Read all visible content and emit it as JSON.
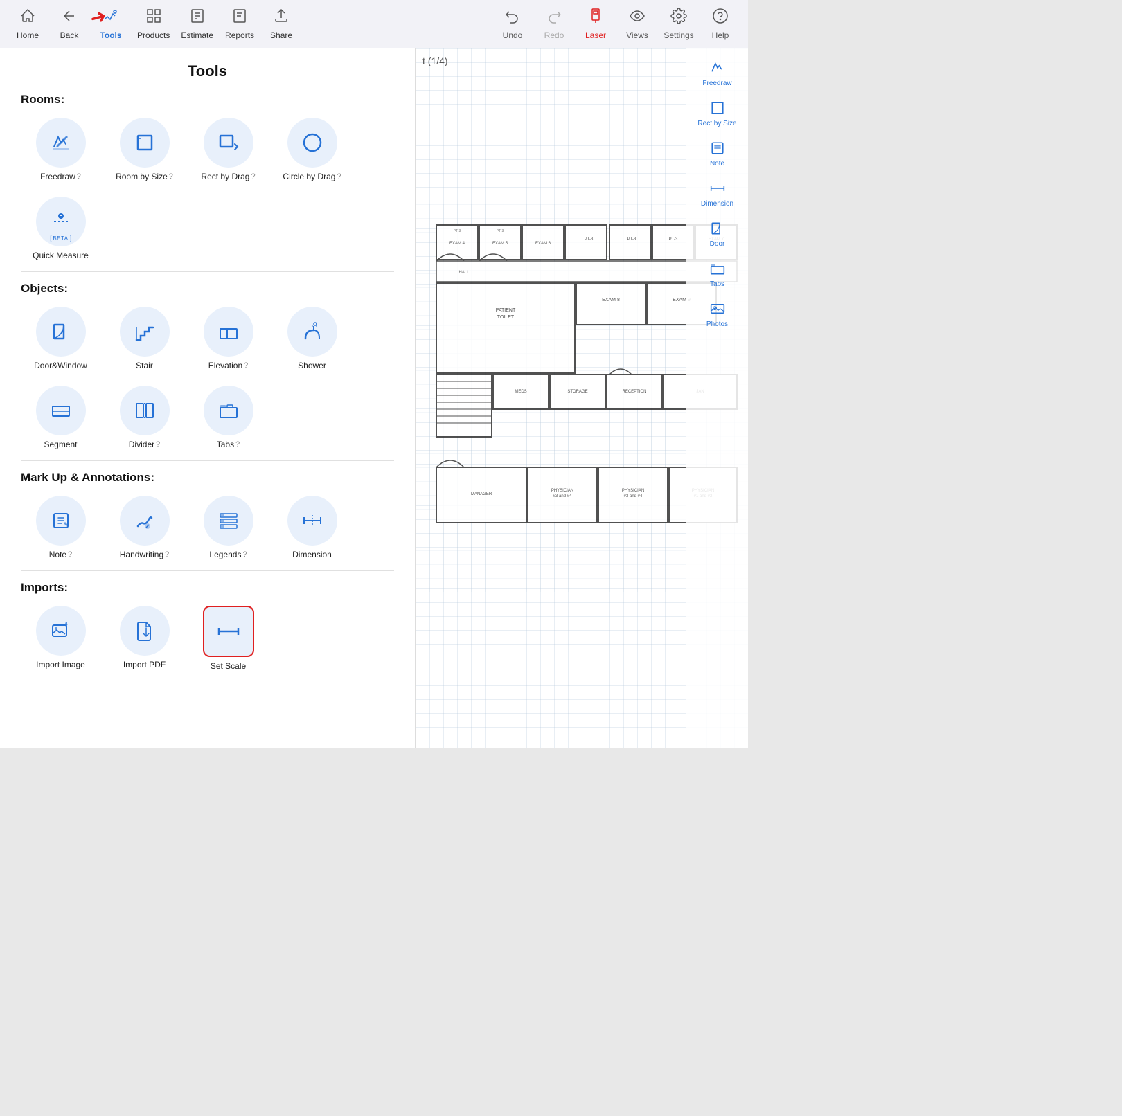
{
  "toolbar": {
    "title": "Tools",
    "items": [
      {
        "id": "home",
        "label": "Home",
        "icon": "🏠"
      },
      {
        "id": "back",
        "label": "Back",
        "icon": "←"
      },
      {
        "id": "tools",
        "label": "Tools",
        "icon": "✏️",
        "active": true
      },
      {
        "id": "products",
        "label": "Products",
        "icon": "📦"
      },
      {
        "id": "estimate",
        "label": "Estimate",
        "icon": "🧮"
      },
      {
        "id": "reports",
        "label": "Reports",
        "icon": "📋"
      },
      {
        "id": "share",
        "label": "Share",
        "icon": "⬆️"
      }
    ],
    "right_items": [
      {
        "id": "undo",
        "label": "Undo",
        "icon": "↩️"
      },
      {
        "id": "redo",
        "label": "Redo",
        "icon": "↪️"
      },
      {
        "id": "laser",
        "label": "Laser",
        "icon": "📱",
        "red": true
      },
      {
        "id": "views",
        "label": "Views",
        "icon": "👁️"
      },
      {
        "id": "settings",
        "label": "Settings",
        "icon": "⚙️"
      },
      {
        "id": "help",
        "label": "Help",
        "icon": "❓"
      }
    ]
  },
  "tools_panel": {
    "title": "Tools",
    "sections": [
      {
        "id": "rooms",
        "label": "Rooms:",
        "items": [
          {
            "id": "freedraw",
            "label": "Freedraw",
            "help": true
          },
          {
            "id": "room-by-size",
            "label": "Room by Size",
            "help": true
          },
          {
            "id": "rect-by-drag",
            "label": "Rect by Drag",
            "help": true
          },
          {
            "id": "circle-by-drag",
            "label": "Circle by Drag",
            "help": true
          },
          {
            "id": "quick-measure",
            "label": "Quick Measure",
            "beta": true
          }
        ]
      },
      {
        "id": "objects",
        "label": "Objects:",
        "items": [
          {
            "id": "door-window",
            "label": "Door&Window"
          },
          {
            "id": "stair",
            "label": "Stair"
          },
          {
            "id": "elevation",
            "label": "Elevation",
            "help": true
          },
          {
            "id": "shower",
            "label": "Shower"
          },
          {
            "id": "segment",
            "label": "Segment"
          },
          {
            "id": "divider",
            "label": "Divider",
            "help": true
          },
          {
            "id": "tabs",
            "label": "Tabs",
            "help": true
          }
        ]
      },
      {
        "id": "markup",
        "label": "Mark Up & Annotations:",
        "items": [
          {
            "id": "note",
            "label": "Note",
            "help": true
          },
          {
            "id": "handwriting",
            "label": "Handwriting",
            "help": true
          },
          {
            "id": "legends",
            "label": "Legends",
            "help": true
          },
          {
            "id": "dimension",
            "label": "Dimension"
          }
        ]
      },
      {
        "id": "imports",
        "label": "Imports:",
        "items": [
          {
            "id": "import-image",
            "label": "Import Image"
          },
          {
            "id": "import-pdf",
            "label": "Import PDF"
          },
          {
            "id": "set-scale",
            "label": "Set Scale",
            "selected": true
          }
        ]
      }
    ]
  },
  "blueprint": {
    "scale": "t (1/4)"
  },
  "right_sidebar": [
    {
      "id": "freedraw",
      "label": "Freedraw"
    },
    {
      "id": "rect-by-size",
      "label": "Rect by Size"
    },
    {
      "id": "note",
      "label": "Note"
    },
    {
      "id": "dimension",
      "label": "Dimension"
    },
    {
      "id": "door",
      "label": "Door"
    },
    {
      "id": "tabs",
      "label": "Tabs"
    },
    {
      "id": "photos",
      "label": "Photos"
    }
  ]
}
